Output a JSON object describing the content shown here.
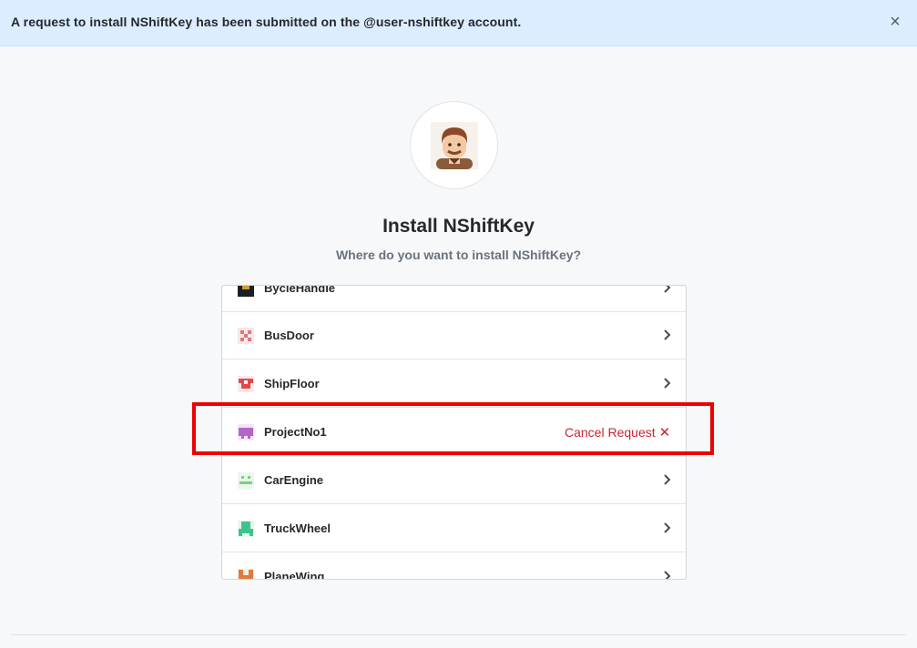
{
  "flash": {
    "message": "A request to install NShiftKey has been submitted on the @user-nshiftkey account.",
    "close_glyph": "×"
  },
  "app": {
    "title": "Install NShiftKey",
    "subtitle": "Where do you want to install NShiftKey?"
  },
  "repos": [
    {
      "name": "BycleHandle",
      "icon_color": "#1b1f23",
      "action": "chevron"
    },
    {
      "name": "BusDoor",
      "icon_color": "#d97a7a",
      "action": "chevron"
    },
    {
      "name": "ShipFloor",
      "icon_color": "#e04a4a",
      "action": "chevron"
    },
    {
      "name": "ProjectNo1",
      "icon_color": "#b565c9",
      "action": "cancel"
    },
    {
      "name": "CarEngine",
      "icon_color": "#7fcf7f",
      "action": "chevron"
    },
    {
      "name": "TruckWheel",
      "icon_color": "#3ec48a",
      "action": "chevron"
    },
    {
      "name": "PlaneWing",
      "icon_color": "#e07a3a",
      "action": "chevron"
    }
  ],
  "cancel_request": {
    "label": "Cancel Request",
    "glyph": "✕",
    "color": "#cb2431"
  },
  "colors": {
    "flash_bg": "#dbedff",
    "highlight": "#ee0000"
  }
}
